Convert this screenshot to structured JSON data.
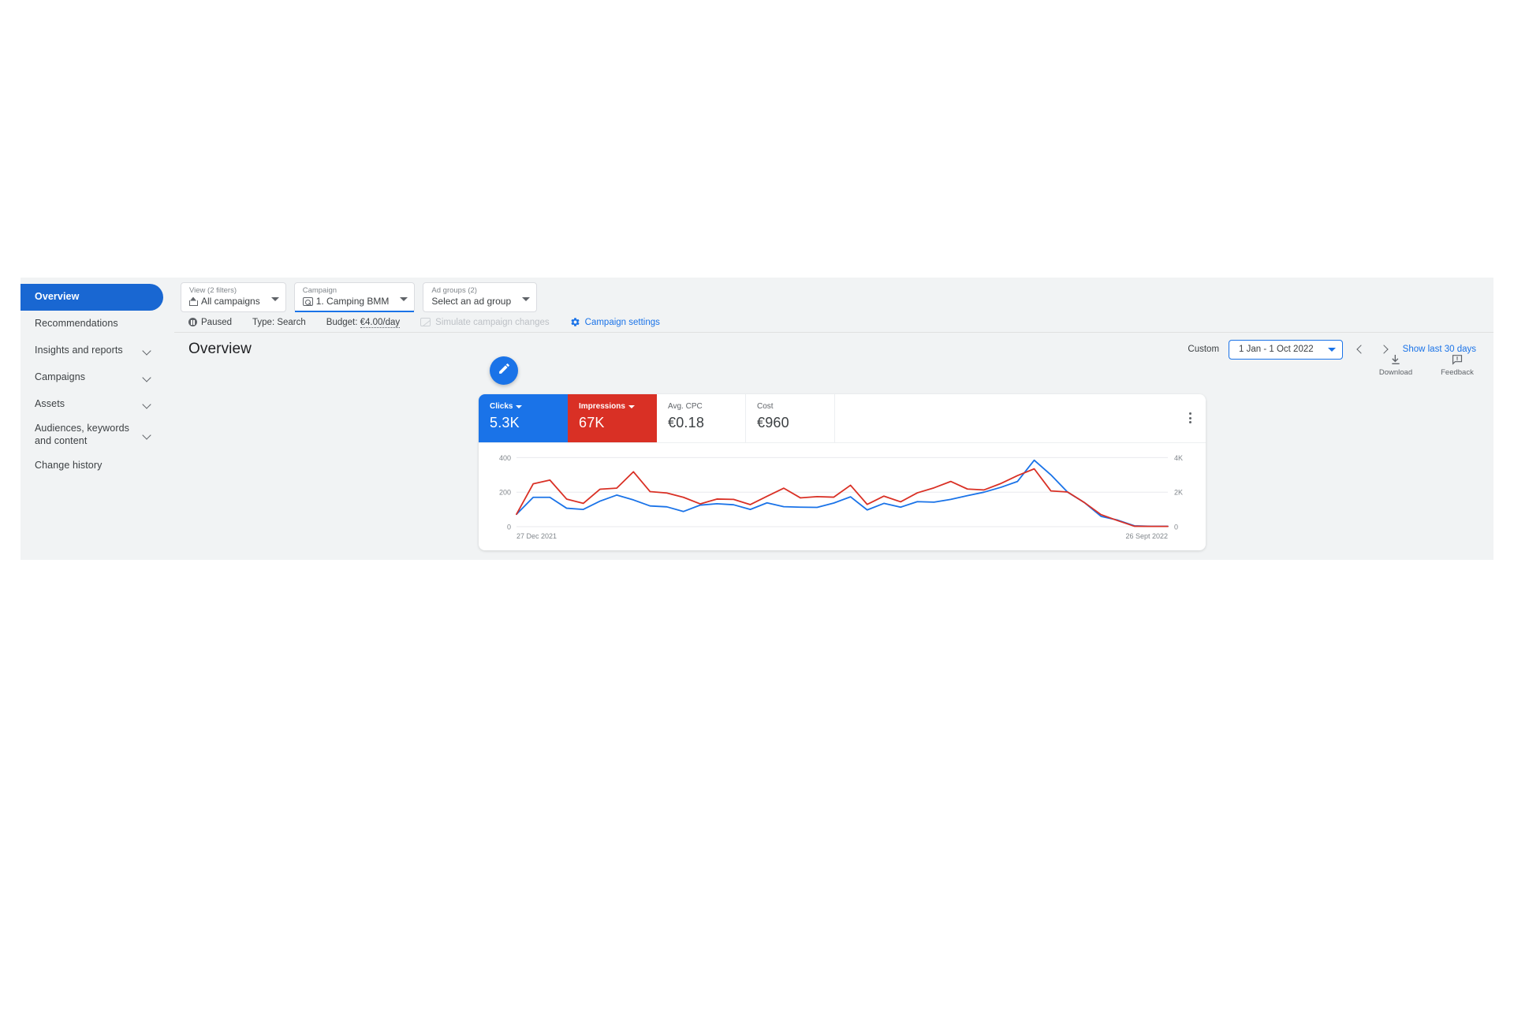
{
  "sidebar": {
    "items": [
      {
        "label": "Overview",
        "active": true,
        "expandable": false
      },
      {
        "label": "Recommendations",
        "active": false,
        "expandable": false
      },
      {
        "label": "Insights and reports",
        "active": false,
        "expandable": true
      },
      {
        "label": "Campaigns",
        "active": false,
        "expandable": true
      },
      {
        "label": "Assets",
        "active": false,
        "expandable": true
      },
      {
        "label": "Audiences, keywords and content",
        "active": false,
        "expandable": true
      },
      {
        "label": "Change history",
        "active": false,
        "expandable": false
      }
    ]
  },
  "toolbar": {
    "view": {
      "label": "View (2 filters)",
      "value": "All campaigns",
      "icon": "home-icon"
    },
    "campaign": {
      "label": "Campaign",
      "value": "1. Camping BMM",
      "icon": "search-campaign-icon"
    },
    "ad_groups": {
      "label": "Ad groups (2)",
      "value": "Select an ad group"
    }
  },
  "status_bar": {
    "status": "Paused",
    "type": "Type: Search",
    "budget_label": "Budget:",
    "budget_value": "€4.00/day",
    "simulate": "Simulate campaign changes",
    "campaign_settings": "Campaign settings"
  },
  "page": {
    "title": "Overview",
    "date_mode": "Custom",
    "date_range": "1 Jan - 1 Oct 2022",
    "show_last_30": "Show last 30 days"
  },
  "actions": {
    "download": "Download",
    "feedback": "Feedback"
  },
  "metrics": [
    {
      "name": "Clicks",
      "value": "5.3K",
      "state": "selected-blue",
      "has_caret": true
    },
    {
      "name": "Impressions",
      "value": "67K",
      "state": "selected-red",
      "has_caret": true
    },
    {
      "name": "Avg. CPC",
      "value": "€0.18",
      "state": "plain",
      "has_caret": false
    },
    {
      "name": "Cost",
      "value": "€960",
      "state": "plain",
      "has_caret": false
    }
  ],
  "colors": {
    "clicks": "#1a73e8",
    "impressions": "#d93025",
    "link": "#1a73e8",
    "sidebar_active_bg": "#1967d2",
    "app_bg": "#f1f3f4"
  },
  "chart_data": {
    "type": "line",
    "title": "",
    "xlabel": "",
    "ylabel": "",
    "x_tick_labels": [
      "27 Dec 2021",
      "26 Sept 2022"
    ],
    "left_axis": {
      "label": "Clicks",
      "ticks": [
        0,
        200,
        400
      ],
      "ylim": [
        0,
        420
      ],
      "color": "#1a73e8"
    },
    "right_axis": {
      "label": "Impressions",
      "ticks": [
        "0",
        "2K",
        "4K"
      ],
      "ylim": [
        0,
        4200
      ],
      "color": "#d93025"
    },
    "grid": true,
    "legend_position": "none",
    "n_points": 40,
    "series": [
      {
        "name": "Clicks",
        "color": "#1a73e8",
        "axis": "left",
        "values": [
          72,
          170,
          170,
          107,
          100,
          148,
          183,
          155,
          120,
          115,
          88,
          125,
          133,
          127,
          100,
          138,
          116,
          113,
          112,
          137,
          173,
          97,
          135,
          113,
          145,
          142,
          158,
          180,
          200,
          228,
          262,
          385,
          300,
          200,
          140,
          60,
          38,
          5,
          2,
          2
        ]
      },
      {
        "name": "Impressions",
        "color": "#d93025",
        "axis": "right",
        "values": [
          720,
          2480,
          2700,
          1600,
          1350,
          2170,
          2230,
          3180,
          2030,
          1950,
          1700,
          1320,
          1600,
          1580,
          1280,
          1760,
          2230,
          1670,
          1740,
          1710,
          2400,
          1290,
          1770,
          1440,
          1960,
          2250,
          2620,
          2180,
          2130,
          2500,
          2960,
          3350,
          2070,
          2010,
          1400,
          700,
          350,
          25,
          18,
          18
        ]
      }
    ]
  }
}
